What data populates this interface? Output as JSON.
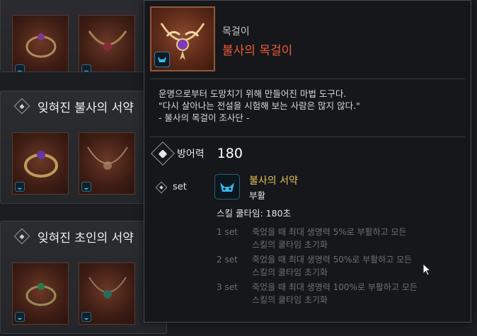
{
  "background": {
    "panels": [
      {
        "title": ""
      },
      {
        "title": "잊혀진 불사의 서약"
      },
      {
        "title": "잊혀진 초인의 서약"
      }
    ]
  },
  "tooltip": {
    "item_type": "목걸이",
    "item_name": "불사의 목걸이",
    "item_name_color": "#f05a38",
    "description": [
      "운명으로부터 도망치기 위해 만들어진 마법 도구다.",
      "\"다시 살아나는 전설을 시험해 보는 사람은 많지 않다.\"",
      "- 불사의 목걸이 조사단 -"
    ],
    "stat": {
      "icon": "shield-icon",
      "label": "방어력",
      "value": "180"
    },
    "set_label": "set",
    "set_name": "불사의 서약",
    "set_name_color": "#e9c45c",
    "set_subtitle": "부활",
    "cooldown": "스킬 쿨타임: 180초",
    "set_effects": [
      {
        "count": "1 set",
        "lines": [
          "죽었을 때 최대 생명력 5%로 부활하고 모든",
          "스킬의 쿨타임 초기화"
        ]
      },
      {
        "count": "2 set",
        "lines": [
          "죽었을 때 최대 생명력 50%로 부활하고 모든",
          "스킬의 쿨타임 초기화"
        ]
      },
      {
        "count": "3 set",
        "lines": [
          "죽었을 때 최대 생명력 100%로 부활하고 모든",
          "스킬의 쿨타임 초기화"
        ]
      }
    ]
  }
}
